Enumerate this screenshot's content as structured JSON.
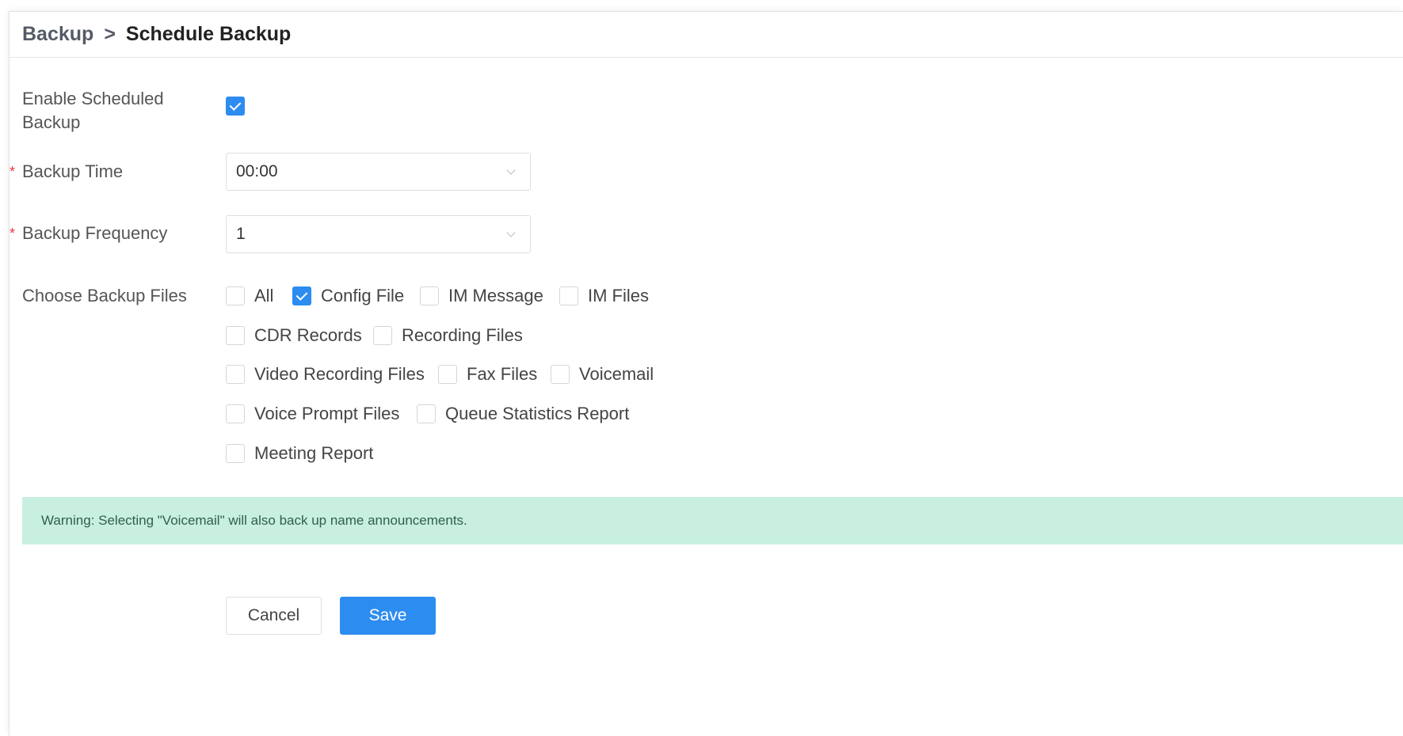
{
  "breadcrumb": {
    "parent": "Backup",
    "separator": ">",
    "current": "Schedule Backup"
  },
  "form": {
    "enable": {
      "label": "Enable Scheduled Backup",
      "line1": "Enable Scheduled",
      "line2": "Backup",
      "checked": true
    },
    "backup_time": {
      "label": "Backup Time",
      "required_mark": "*",
      "value": "00:00"
    },
    "backup_frequency": {
      "label": "Backup Frequency",
      "required_mark": "*",
      "value": "1"
    },
    "files": {
      "label": "Choose Backup Files",
      "options": [
        {
          "label": "All",
          "checked": false
        },
        {
          "label": "Config File",
          "checked": true
        },
        {
          "label": "IM Message",
          "checked": false
        },
        {
          "label": "IM Files",
          "checked": false
        },
        {
          "label": "CDR Records",
          "checked": false
        },
        {
          "label": "Recording Files",
          "checked": false
        },
        {
          "label": "Video Recording Files",
          "checked": false
        },
        {
          "label": "Fax Files",
          "checked": false
        },
        {
          "label": "Voicemail",
          "checked": false
        },
        {
          "label": "Voice Prompt Files",
          "checked": false
        },
        {
          "label": "Queue Statistics Report",
          "checked": false
        },
        {
          "label": "Meeting Report",
          "checked": false
        }
      ]
    }
  },
  "warning": "Warning: Selecting \"Voicemail\" will also back up name announcements.",
  "buttons": {
    "cancel": "Cancel",
    "save": "Save"
  },
  "colors": {
    "accent": "#2d8cf0",
    "required": "#e8383d",
    "warning_bg": "#c9efe0"
  }
}
